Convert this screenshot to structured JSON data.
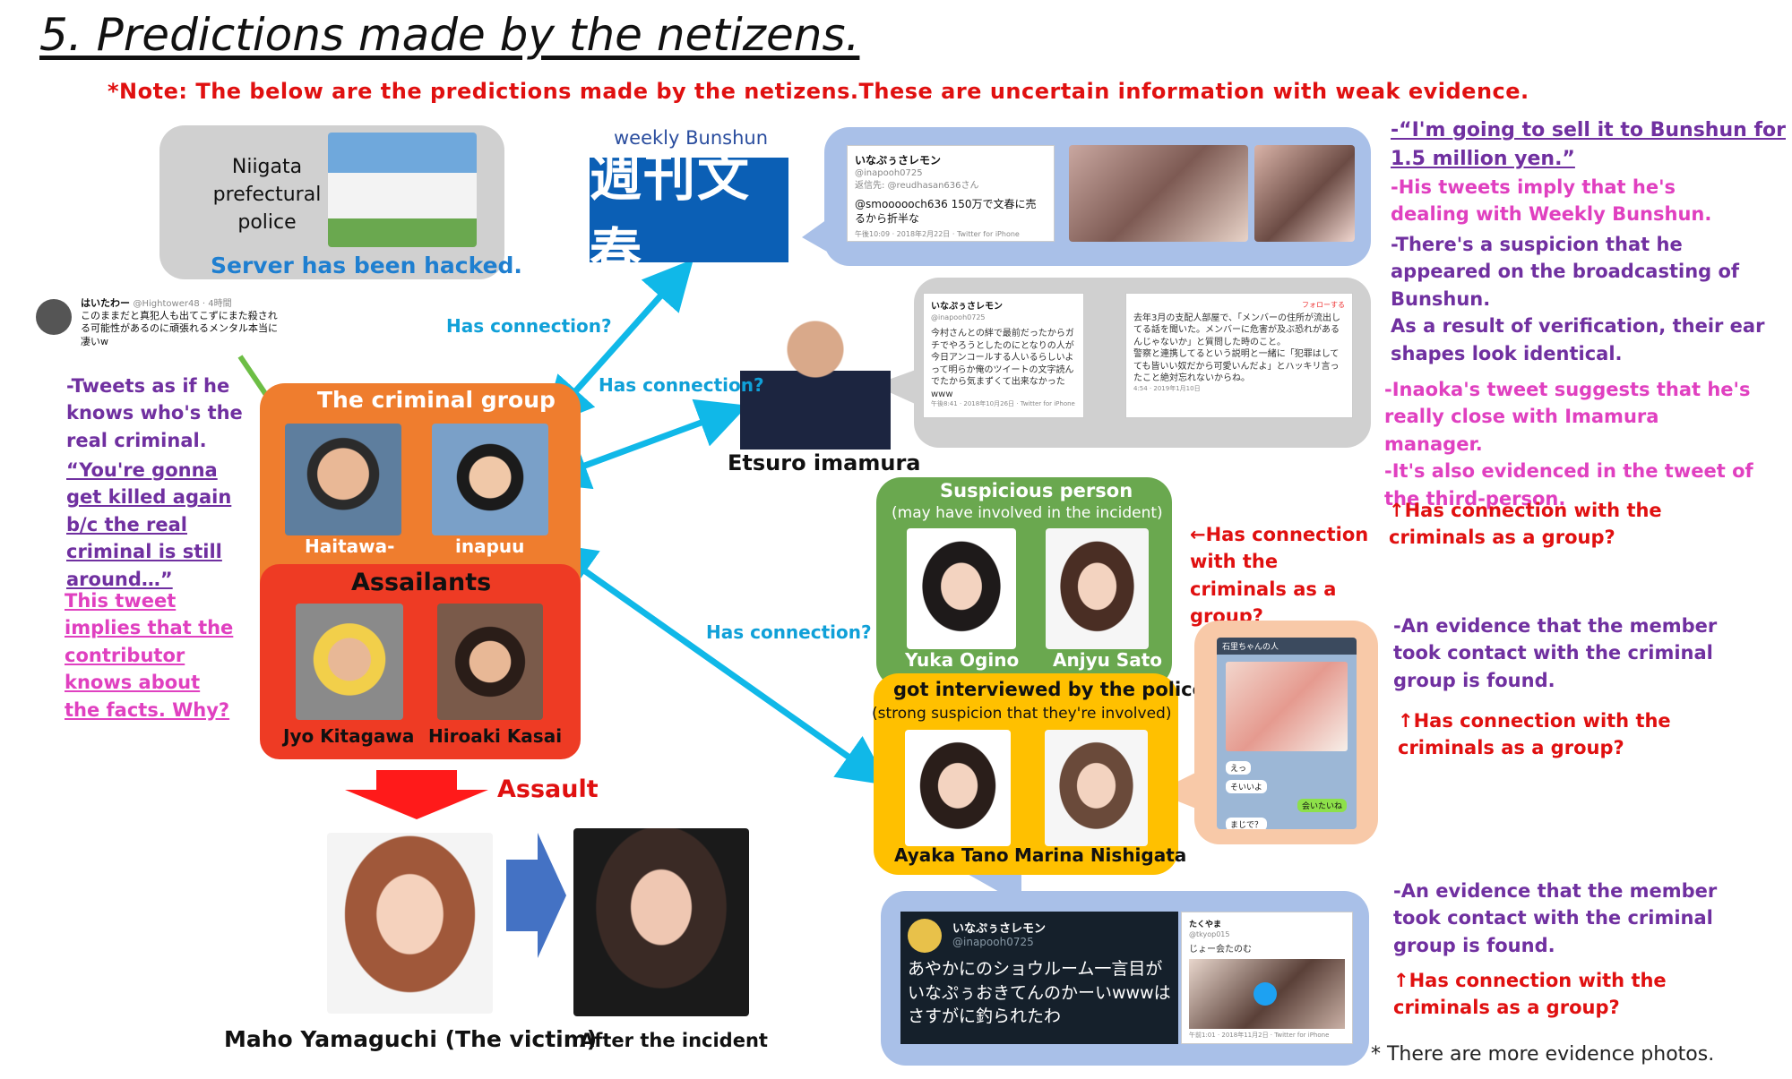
{
  "title": "5.  Predictions made by the netizens.",
  "note": "*Note: The below are the predictions made by the netizens.These are uncertain information with weak evidence.",
  "police": {
    "label": "Niigata\nprefectural\npolice",
    "hacked": "Server has been hacked."
  },
  "bunshun": {
    "caption": "weekly Bunshun",
    "logo": "週刊文春"
  },
  "haitawa_tweet": {
    "name": "はいたわー",
    "handle": "@Hightower48 · 4時間",
    "text": "このままだと真犯人も出てこずにまた殺される可能性があるのに頑張れるメンタル本当に凄いw"
  },
  "left_notes": {
    "tweets_as_if": "-Tweets as if he knows who's the real criminal.",
    "quote": "“You're gonna get killed again b/c the real criminal is still around…”",
    "implies": "This tweet implies that the contributor knows about the facts. Why?"
  },
  "criminal_group": {
    "title": "The criminal group",
    "members": [
      "Haitawa-",
      "inapuu"
    ],
    "assailants_title": "Assailants",
    "assailants": [
      "Jyo Kitagawa",
      "Hiroaki Kasai"
    ]
  },
  "assault_label": "Assault",
  "victim_label": "Maho Yamaguchi (The victim)",
  "after_label": "After the incident",
  "connections": {
    "c1": "Has connection?",
    "c2": "Has connection?",
    "c3": "Has connection?"
  },
  "etsuro": "Etsuro imamura",
  "tweet_top": {
    "name": "いなぷぅさレモン",
    "handle": "@inapooh0725",
    "reply": "返信先: @reudhasan636さん",
    "text": "@smoooooch636 150万で文春に売るから折半な",
    "meta": "午後10:09 · 2018年2月22日 · Twitter for iPhone"
  },
  "tweet_mid1": {
    "name": "いなぷぅさレモン",
    "handle": "@inapooh0725",
    "text": "今村さんとの絆で最前だったからガチでやろうとしたのにとなりの人が今日アンコールする人いるらしいよって明らか俺のツイートの文字読んでたから気まずくて出来なかったwww",
    "meta": "午後8:41 · 2018年10月26日 · Twitter for iPhone"
  },
  "tweet_mid2": {
    "follow": "フォローする",
    "text": "去年3月の支配人部屋で、「メンバーの住所が流出してる話を聞いた。メンバーに危害が及ぶ恐れがあるんじゃないか」と質問した時のこと。\n警察と連携してるという説明と一緒に「犯罪はしてても皆いい奴だから可愛いんだよ」とハッキリ言ったこと絶対忘れないからね。",
    "meta": "4:54 · 2019年1月10日"
  },
  "right_notes": {
    "quote_line1": "-“I'm going to sell it to Bunshun for",
    "quote_line2": "1.5 million yen.”",
    "dealing": "-His tweets imply that he's dealing with Weekly Bunshun.",
    "suspicion": "-There's a suspicion that he appeared on the broadcasting of Bunshun.\nAs a result of verification, their ear shapes look identical.",
    "inaoka": "-Inaoka's tweet suggests that he's really close with Imamura manager.\n-It's also evidenced in the tweet of the third-person.",
    "has_conn_up1": "↑Has connection with the criminals as a group?",
    "evidence1": "-An evidence that the member took contact with the criminal group is found.",
    "has_conn_up2": "↑Has connection with the criminals as a group?",
    "evidence2": "-An evidence that the member took contact with the criminal group is found.",
    "has_conn_up3": "↑Has connection with the criminals as a group?"
  },
  "suspicious": {
    "title": "Suspicious person",
    "subtitle": "(may have involved in the incident)",
    "members": [
      "Yuka Ogino",
      "Anjyu Sato"
    ],
    "left_arrow_note": "←Has connection with the criminals as a group?"
  },
  "interviewed": {
    "title": "got interviewed by the police",
    "subtitle": "(strong suspicion that they're involved)",
    "members": [
      "Ayaka Tano",
      "Marina Nishigata"
    ]
  },
  "chat": {
    "header": "石里ちゃんの人",
    "msgs": [
      "えっ",
      "そいいよ",
      "まじで？"
    ],
    "reply": "会いたいね"
  },
  "tweet_bottom": {
    "name": "いなぷぅさレモン",
    "handle": "@inapooh0725",
    "text": "あやかにのショウルーム一言目がいなぷぅおきてんのかーいwwwはさすがに釣られたわ",
    "side_name": "たくやま",
    "side_handle": "@tkyop015",
    "side_text": "じょー会たのむ",
    "side_meta": "午前1:01 · 2018年11月2日 · Twitter for iPhone"
  },
  "footnote": "* There are more evidence photos.",
  "colors": {
    "orange": "#ef7d2e",
    "red_box": "#ee3b24",
    "green_box": "#6aa84f",
    "yellow_box": "#ffc000",
    "peach": "#f8c9a8",
    "blue_bubble": "#a9c0e8",
    "gray_bubble": "#d0d0d0",
    "arrow_blue": "#10b8e8",
    "bunshun_blue": "#0b5fb5"
  }
}
